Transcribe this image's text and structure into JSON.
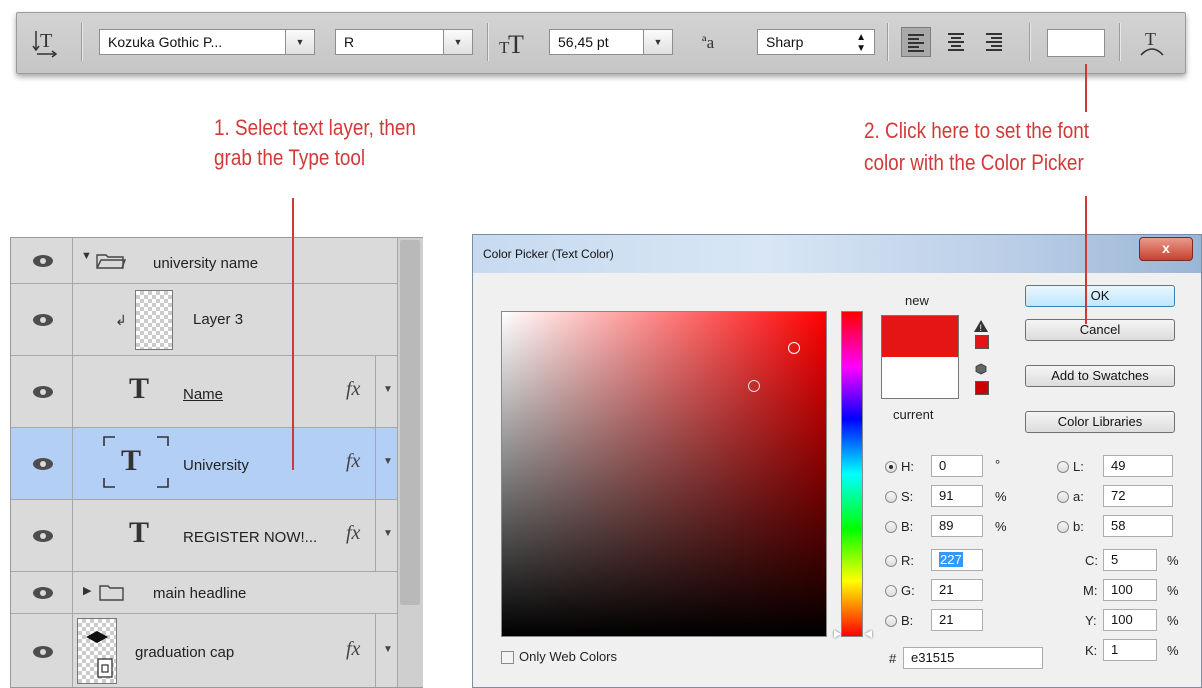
{
  "options_bar": {
    "orient_icon": "text-orientation-icon",
    "font_family": "Kozuka Gothic P...",
    "font_style": "R",
    "size_icon": "font-size-icon",
    "font_size": "56,45 pt",
    "aa_icon": "anti-alias-icon",
    "aa_icon_text": "ªa",
    "antialias": "Sharp",
    "align_icons": [
      "align-left-icon",
      "align-center-icon",
      "align-right-icon"
    ],
    "color_swatch": "#ffffff",
    "warp_icon": "warp-text-icon"
  },
  "annotations": {
    "step1_line1": "1. Select text layer, then",
    "step1_line2": "grab the Type tool",
    "step2_line1": "2. Click here to set the font",
    "step2_line2": "color with the Color Picker",
    "color": "#d23a3a"
  },
  "layers": [
    {
      "name": "university name",
      "type": "group-open"
    },
    {
      "name": "Layer 3",
      "type": "clipped-raster"
    },
    {
      "name": "Name",
      "type": "text",
      "fx": "fx"
    },
    {
      "name": "University",
      "type": "text",
      "fx": "fx",
      "selected": true
    },
    {
      "name": "REGISTER NOW!...",
      "type": "text",
      "fx": "fx"
    },
    {
      "name": "main headline",
      "type": "group-closed"
    },
    {
      "name": "graduation cap",
      "type": "smart-object",
      "fx": "fx"
    }
  ],
  "color_picker": {
    "title": "Color Picker (Text Color)",
    "close": "x",
    "new_label": "new",
    "current_label": "current",
    "new_color": "#e31515",
    "current_color": "#ffffff",
    "buttons": {
      "ok": "OK",
      "cancel": "Cancel",
      "add": "Add to Swatches",
      "libraries": "Color Libraries"
    },
    "hsb": {
      "h_label": "H:",
      "h": "0",
      "h_unit": "°",
      "s_label": "S:",
      "s": "91",
      "s_unit": "%",
      "b_label": "B:",
      "b": "89",
      "b_unit": "%"
    },
    "rgb": {
      "r_label": "R:",
      "r": "227",
      "g_label": "G:",
      "g": "21",
      "b_label": "B:",
      "b": "21"
    },
    "lab": {
      "l_label": "L:",
      "l": "49",
      "a_label": "a:",
      "a": "72",
      "b_label": "b:",
      "b": "58"
    },
    "cmyk": {
      "c_label": "C:",
      "c": "5",
      "m_label": "M:",
      "m": "100",
      "y_label": "Y:",
      "y": "100",
      "k_label": "K:",
      "k": "1",
      "unit": "%"
    },
    "hex_label": "#",
    "hex": "e31515",
    "only_web": "Only Web Colors"
  }
}
